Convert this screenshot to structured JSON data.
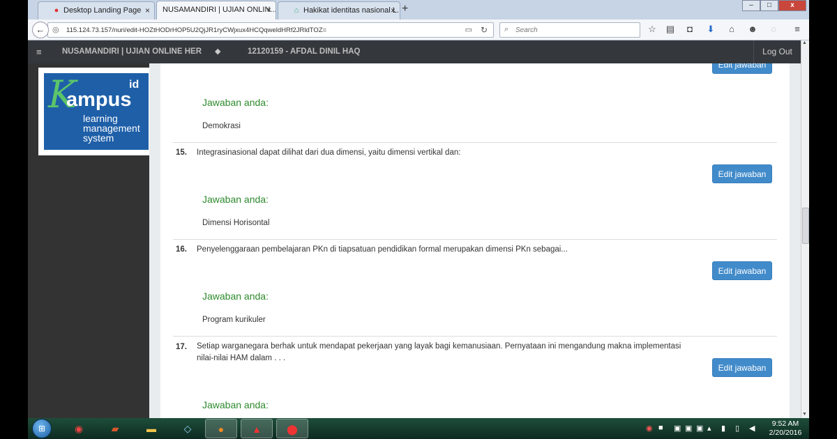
{
  "browser": {
    "tabs": [
      {
        "label": "Desktop Landing Page",
        "icon": "red-favicon",
        "active": false
      },
      {
        "label": "NUSAMANDIRI | UJIAN ONLIN...",
        "icon": "none",
        "active": true
      },
      {
        "label": "Hakikat identitas nasional L...",
        "icon": "house-favicon",
        "active": false
      }
    ],
    "new_tab": "+",
    "close_glyph": "×",
    "url": "115.124.73.157/nuri/edit-HOZtHODrHOP5U2QjJR1ryCWjxux4HCQqweldHRf2JRldTOZ=",
    "search_placeholder": "Search",
    "window_controls": {
      "minimize": "–",
      "maximize": "□",
      "close": "x"
    }
  },
  "header": {
    "site_title": "NUSAMANDIRI | UJIAN ONLINE HER",
    "user": "12120159 - AFDAL DINIL HAQ",
    "logout": "Log Out"
  },
  "logo": {
    "brand_k": "K",
    "brand_rest": "ampus",
    "brand_suffix": "id",
    "tagline": "learning management system"
  },
  "content": {
    "top_edit_label": "Edit jawaban",
    "top_answer_label": "Jawaban anda:",
    "top_answer": "Demokrasi",
    "questions": [
      {
        "number": "15.",
        "text": "Integrasinasional dapat dilihat dari dua dimensi,  yaitu dimensi vertikal dan:",
        "edit_label": "Edit jawaban",
        "answer_label": "Jawaban anda:",
        "answer": "Dimensi Horisontal"
      },
      {
        "number": "16.",
        "text": "Penyelenggaraan pembelajaran PKn di tiapsatuan pendidikan formal merupakan dimensi PKn sebagai...",
        "edit_label": "Edit jawaban",
        "answer_label": "Jawaban anda:",
        "answer": "Program kurikuler"
      },
      {
        "number": "17.",
        "text": "Setiap warganegara berhak untuk mendapat pekerjaan yang layak bagi kemanusiaan. Pernyataan ini mengandung makna implementasi nilai-nilai HAM dalam . . .",
        "edit_label": "Edit jawaban",
        "answer_label": "Jawaban anda:",
        "answer": ""
      }
    ]
  },
  "taskbar": {
    "apps": [
      "chrome-icon",
      "books-icon",
      "folder-icon",
      "notepad-icon",
      "firefox-icon",
      "pdf-icon",
      "recorder-icon"
    ],
    "clock_time": "9:52 AM",
    "clock_date": "2/20/2016"
  },
  "colors": {
    "accent": "#428bca",
    "answer_label": "#2d8a2d",
    "header_bg": "#34383c"
  }
}
